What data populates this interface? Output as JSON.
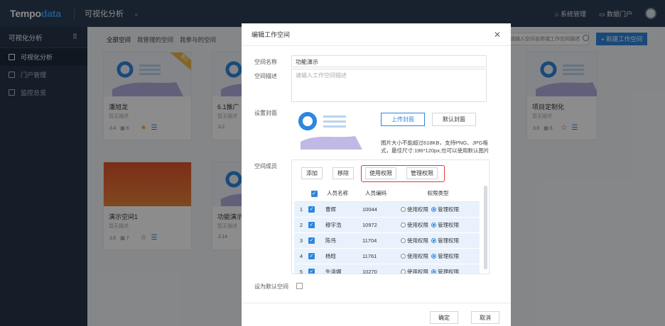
{
  "topbar": {
    "logo_main": "Tempo",
    "logo_accent": "data",
    "app_name": "可视化分析",
    "chevron": "⌄",
    "system_admin": "系统管理",
    "data_portal": "数据门户",
    "home_icon": "home-icon",
    "portal_icon": "monitor-icon"
  },
  "sidebar": {
    "title": "可视化分析",
    "grid_icon": "grid-icon",
    "items": [
      {
        "label": "可视化分析",
        "icon": "chart-icon",
        "active": true
      },
      {
        "label": "门户管理",
        "icon": "portal-icon",
        "active": false
      },
      {
        "label": "监控总览",
        "icon": "monitor-icon",
        "active": false
      }
    ]
  },
  "main": {
    "tabs": [
      "全部空间",
      "我管理的空间",
      "我参与的空间"
    ],
    "search_placeholder": "请输入空间名称或工作空间描述",
    "new_button": "+ 新建工作空间",
    "cards": [
      {
        "title": "潘旭龙",
        "desc": "暂无描述",
        "members": "4",
        "items": "6",
        "ribbon": "默认",
        "starred": true
      },
      {
        "title": "6.1推广",
        "desc": "暂无描述",
        "members": "2",
        "items": ""
      },
      {
        "title": "项目定制化",
        "desc": "暂无描述",
        "members": "8",
        "items": "6",
        "starred": false
      },
      {
        "title": "演示空间1",
        "desc": "暂无描述",
        "members": "6",
        "items": "7",
        "starred": false
      },
      {
        "title": "功能演示",
        "desc": "暂无描述",
        "members": "14",
        "items": ""
      }
    ]
  },
  "dialog": {
    "title": "编辑工作空间",
    "close": "✕",
    "name_label": "空间名称",
    "name_value": "功能演示",
    "desc_label": "空间描述",
    "desc_placeholder": "请输入工作空间描述",
    "cover_label": "设置封面",
    "upload_cover": "上传封面",
    "default_cover": "默认封面",
    "cover_note": "图片大小不能超过618KB，支持PNG、JPG格式，最佳尺寸:196*120px,也可以使用默认图片",
    "members_label": "空间成员",
    "add": "添加",
    "remove": "移除",
    "use_perm": "使用权限",
    "manage_perm": "管理权限",
    "columns": [
      "人员名称",
      "人员编码",
      "权限类型"
    ],
    "rows": [
      {
        "idx": "1",
        "name": "曹辉",
        "code": "10044"
      },
      {
        "idx": "2",
        "name": "穆宇浩",
        "code": "10972"
      },
      {
        "idx": "3",
        "name": "陈伟",
        "code": "11704"
      },
      {
        "idx": "4",
        "name": "杨晗",
        "code": "11761"
      },
      {
        "idx": "5",
        "name": "牛清娜",
        "code": "10270"
      }
    ],
    "radio_use": "使用权限",
    "radio_manage": "管理权限",
    "default_label": "设为默认空间",
    "confirm": "确定",
    "cancel": "取消"
  },
  "colors": {
    "accent": "#2f86de",
    "highlight": "#e23a2f",
    "topbar": "#2c3d55"
  }
}
